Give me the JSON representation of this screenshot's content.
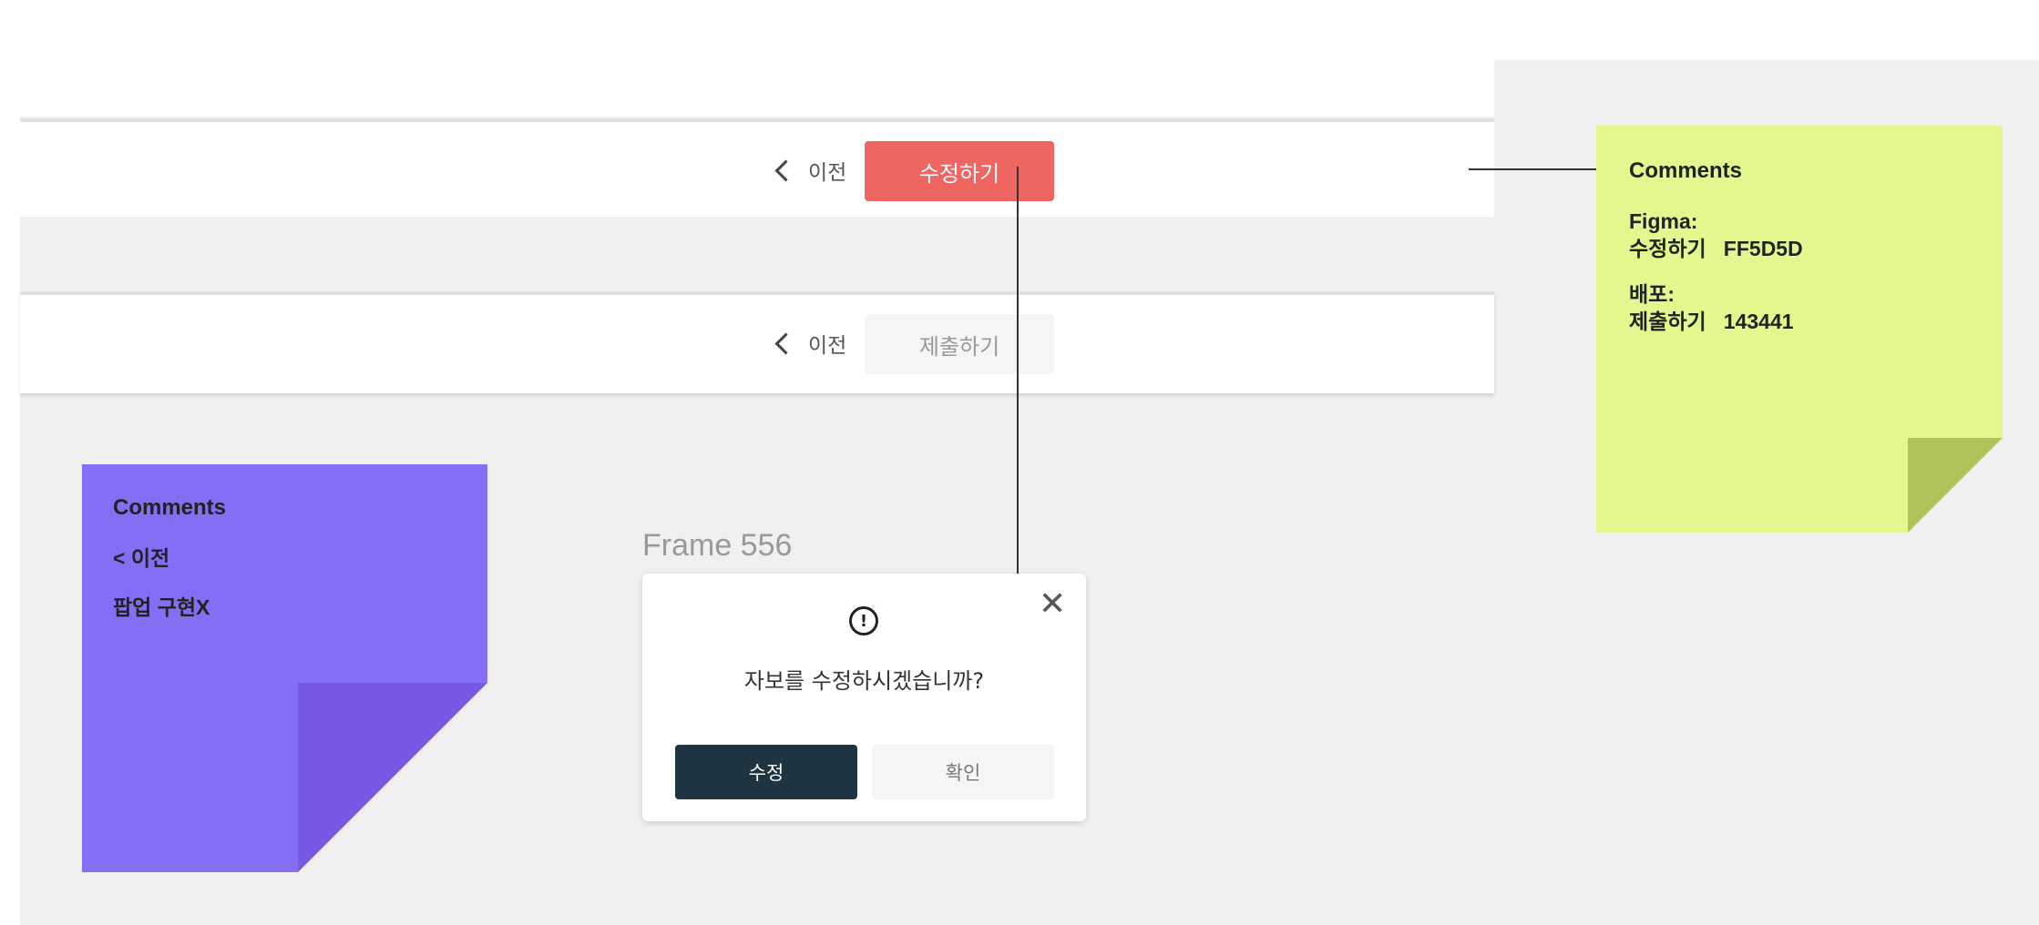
{
  "bars": {
    "bar1": {
      "prev_label": "이전",
      "primary_label": "수정하기"
    },
    "bar2": {
      "prev_label": "이전",
      "primary_label": "제출하기"
    }
  },
  "colors": {
    "edit_button": "#ee6561",
    "modal_edit_button": "#1f3441",
    "sticky_purple": "#846ef4",
    "sticky_green": "#e2f88e",
    "canvas": "#f0f0f0"
  },
  "sticky_purple": {
    "title": "Comments",
    "lines": [
      "< 이전",
      "팝업 구현X"
    ]
  },
  "sticky_green": {
    "title": "Comments",
    "figma_label": "Figma:",
    "figma_line": "수정하기   FF5D5D",
    "deploy_label": "배포:",
    "deploy_line": "제출하기   143441"
  },
  "frame": {
    "label": "Frame 556"
  },
  "modal": {
    "icon": "alert-circle-icon",
    "message": "자보를 수정하시겠습니까?",
    "edit_button": "수정",
    "confirm_button": "확인",
    "close_icon": "close-icon"
  }
}
